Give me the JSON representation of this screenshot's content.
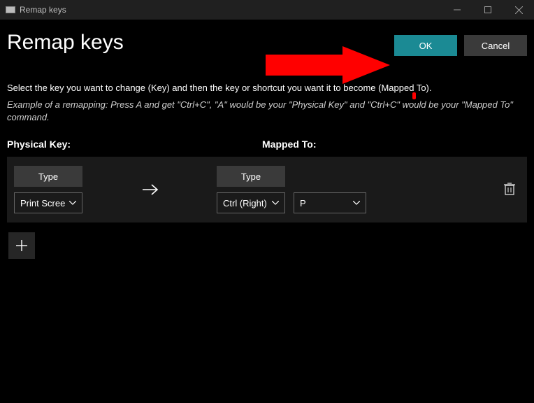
{
  "window": {
    "title": "Remap keys"
  },
  "header": {
    "page_title": "Remap keys",
    "ok_label": "OK",
    "cancel_label": "Cancel"
  },
  "text": {
    "instructions": "Select the key you want to change (Key) and then the key or shortcut you want it to become (Mapped To).",
    "example": "Example of a remapping: Press A and get \"Ctrl+C\", \"A\" would be your \"Physical Key\" and \"Ctrl+C\" would be your \"Mapped To\" command."
  },
  "columns": {
    "physical": "Physical Key:",
    "mapped": "Mapped To:"
  },
  "buttons": {
    "type": "Type"
  },
  "mapping": {
    "physical_value": "Print Scree",
    "mapped_mod": "Ctrl (Right)",
    "mapped_key": "P"
  }
}
